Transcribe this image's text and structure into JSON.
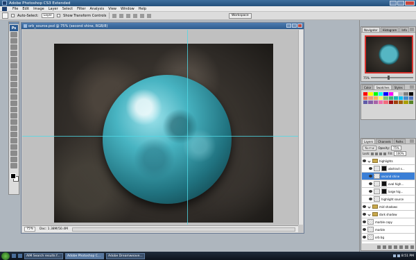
{
  "window": {
    "title": "Adobe Photoshop CS3 Extended"
  },
  "menu": {
    "items": [
      "File",
      "Edit",
      "Image",
      "Layer",
      "Select",
      "Filter",
      "Analysis",
      "View",
      "Window",
      "Help"
    ]
  },
  "options": {
    "auto_select_label": "Auto-Select:",
    "auto_select_value": "Layer",
    "show_transform_label": "Show Transform Controls",
    "workspace_label": "Workspace"
  },
  "document": {
    "title": "orb_source.psd @ 75% (second shine, RGB/8)",
    "zoom": "75%",
    "doc_info": "Doc: 1.38M/50.4M"
  },
  "panels": {
    "navigator_tabs": [
      "Navigator",
      "Histogram",
      "Info"
    ],
    "color_tabs": [
      "Color",
      "Swatches",
      "Styles"
    ],
    "layers_tabs": [
      "Layers",
      "Channels",
      "Paths"
    ],
    "blend_mode": "Normal",
    "opacity_label": "Opacity:",
    "opacity_value": "75%",
    "lock_label": "Lock:",
    "fill_label": "Fill:",
    "fill_value": "100%",
    "nav_zoom": "75%"
  },
  "layers": [
    {
      "name": "highlights",
      "type": "group"
    },
    {
      "name": "abstract s...",
      "type": "masked"
    },
    {
      "name": "second shine",
      "type": "layer",
      "selected": true
    },
    {
      "name": "oval high...",
      "type": "masked"
    },
    {
      "name": "large hig...",
      "type": "masked"
    },
    {
      "name": "highlight source",
      "type": "layer"
    },
    {
      "name": "mid shadows",
      "type": "group"
    },
    {
      "name": "dark shadow",
      "type": "group"
    },
    {
      "name": "marble copy",
      "type": "layer"
    },
    {
      "name": "marble",
      "type": "layer"
    },
    {
      "name": "orb bg",
      "type": "layer"
    }
  ],
  "taskbar": {
    "tasks": [
      "AIM Search results f...",
      "Adobe Photoshop C...",
      "Adobe Dreamweave..."
    ],
    "clock": "8:51 PM"
  },
  "colors": {
    "accent": "#3a7fd6",
    "guide": "#4fd9e6",
    "nav_frame": "#d7322e"
  }
}
